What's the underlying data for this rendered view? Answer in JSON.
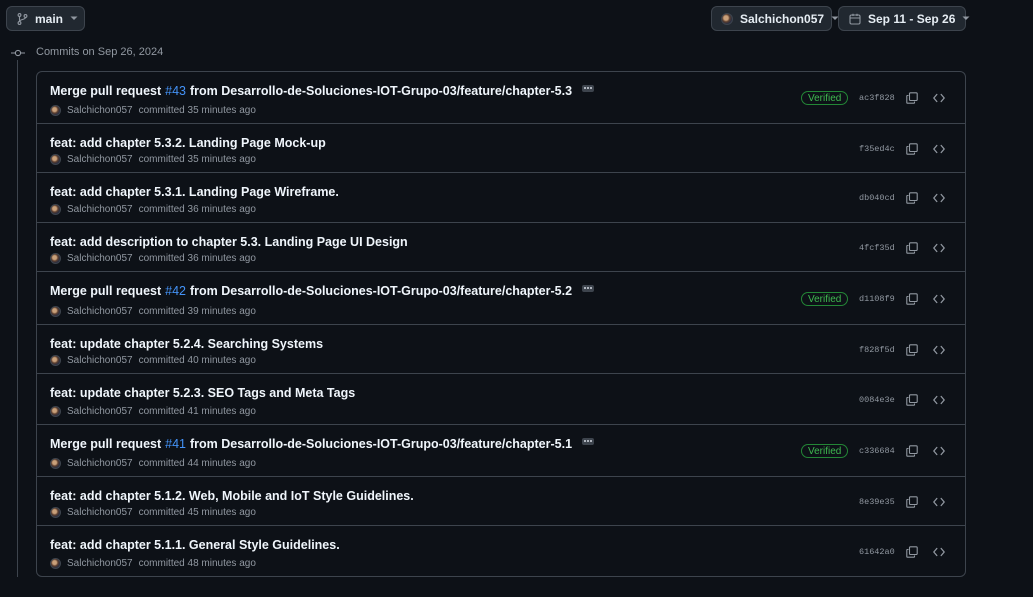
{
  "toolbar": {
    "branch_label": "main",
    "author_label": "Salchichon057",
    "date_range_label": "Sep 11 - Sep 26"
  },
  "group": {
    "heading": "Commits on Sep 26, 2024"
  },
  "commits": [
    {
      "prefix": "Merge pull request",
      "pr": "#43",
      "suffix": "from Desarrollo-de-Soluciones-IOT-Grupo-03/feature/chapter-5.3",
      "author": "Salchichon057",
      "time": "committed 35 minutes ago",
      "verified": "Verified",
      "sha": "ac3f828"
    },
    {
      "prefix": "feat: add chapter 5.3.2. Landing Page Mock-up",
      "pr": "",
      "suffix": "",
      "author": "Salchichon057",
      "time": "committed 35 minutes ago",
      "verified": "",
      "sha": "f35ed4c"
    },
    {
      "prefix": "feat: add chapter 5.3.1. Landing Page Wireframe.",
      "pr": "",
      "suffix": "",
      "author": "Salchichon057",
      "time": "committed 36 minutes ago",
      "verified": "",
      "sha": "db040cd"
    },
    {
      "prefix": "feat: add description to chapter 5.3. Landing Page UI Design",
      "pr": "",
      "suffix": "",
      "author": "Salchichon057",
      "time": "committed 36 minutes ago",
      "verified": "",
      "sha": "4fcf35d"
    },
    {
      "prefix": "Merge pull request",
      "pr": "#42",
      "suffix": "from Desarrollo-de-Soluciones-IOT-Grupo-03/feature/chapter-5.2",
      "author": "Salchichon057",
      "time": "committed 39 minutes ago",
      "verified": "Verified",
      "sha": "d1108f9"
    },
    {
      "prefix": "feat: update chapter 5.2.4. Searching Systems",
      "pr": "",
      "suffix": "",
      "author": "Salchichon057",
      "time": "committed 40 minutes ago",
      "verified": "",
      "sha": "f828f5d"
    },
    {
      "prefix": "feat: update chapter 5.2.3. SEO Tags and Meta Tags",
      "pr": "",
      "suffix": "",
      "author": "Salchichon057",
      "time": "committed 41 minutes ago",
      "verified": "",
      "sha": "0084e3e"
    },
    {
      "prefix": "Merge pull request",
      "pr": "#41",
      "suffix": "from Desarrollo-de-Soluciones-IOT-Grupo-03/feature/chapter-5.1",
      "author": "Salchichon057",
      "time": "committed 44 minutes ago",
      "verified": "Verified",
      "sha": "c336684"
    },
    {
      "prefix": "feat: add chapter 5.1.2. Web, Mobile and IoT Style Guidelines.",
      "pr": "",
      "suffix": "",
      "author": "Salchichon057",
      "time": "committed 45 minutes ago",
      "verified": "",
      "sha": "8e39e35"
    },
    {
      "prefix": "feat: add chapter 5.1.1. General Style Guidelines.",
      "pr": "",
      "suffix": "",
      "author": "Salchichon057",
      "time": "committed 48 minutes ago",
      "verified": "",
      "sha": "61642a0"
    }
  ],
  "icons": {
    "branch": "git-branch-icon",
    "person": "avatar",
    "calendar": "calendar-icon",
    "caret": "chevron-down-icon",
    "timeline": "git-commit-icon",
    "ellipsis": "ellipsis-icon",
    "copy": "copy-icon",
    "browse": "code-icon"
  }
}
